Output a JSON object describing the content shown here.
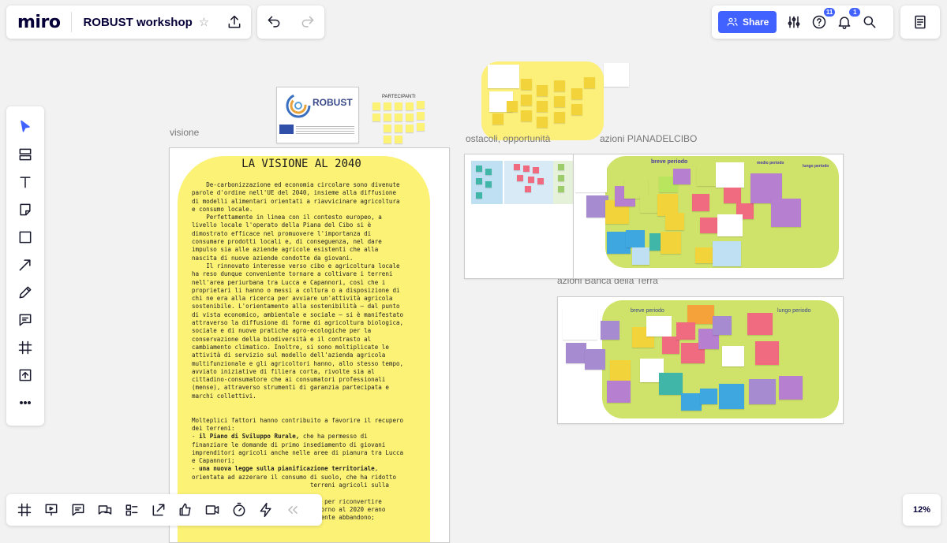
{
  "app": {
    "logo": "miro",
    "board_title": "ROBUST workshop",
    "zoom_level": "12%"
  },
  "toolbar": {
    "share_label": "Share",
    "questions_badge": "11",
    "notifications_badge": "1"
  },
  "canvas": {
    "labels": {
      "visione": "visione",
      "ostacoli": "ostacoli, opportunità",
      "azioni_pianadelcibo": "azioni PIANADELCIBO",
      "azioni_banca": "azioni Banca della Terra",
      "partecipanti": "PARTECIPANTI"
    },
    "robust_logo_text": "ROBUST",
    "vision": {
      "title": "LA VISIONE AL 2040",
      "p1": "    De-carbonizzazione ed economia circolare sono divenute\nparole d'ordine nell'UE del 2040, insieme alla diffusione\ndi modelli alimentari orientati a riavvicinare agricoltura\ne consumo locale.",
      "p2": "    Perfettamente in linea con il contesto europeo, a\nlivello locale l'operato della Piana del Cibo si è\ndimostrato efficace nel promuovere l'importanza di\nconsumare prodotti locali e, di conseguenza, nel dare\nimpulso sia alle aziende agricole esistenti che alla\nnascita di nuove aziende condotte da giovani.",
      "p3": "    Il rinnovato interesse verso cibo e agricoltura locale\nha reso dunque conveniente tornare a coltivare i terreni\nnell'area periurbana tra Lucca e Capannori, così che i\nproprietari li hanno o messi a coltura o a disposizione di\nchi ne era alla ricerca per avviare un'attività agricola\nsostenibile. L'orientamento alla sostenibilità – dal punto\ndi vista economico, ambientale e sociale – si è manifestato\nattraverso la diffusione di forme di agricoltura biologica,\nsociale e di nuove pratiche agro-ecologiche per la\nconservazione della biodiversità e il contrasto al\ncambiamento climatico. Inoltre, si sono moltiplicate le\nattività di servizio sul modello dell'azienda agricola\nmultifunzionale e gli agricoltori hanno, allo stesso tempo,\navviato iniziative di filiera corta, rivolte sia al\ncittadino-consumatore che ai consumatori professionali\n(mense), attraverso strumenti di garanzia partecipata e\nmarchi collettivi.",
      "p4": "Molteplici fattori hanno contribuito a favorire il recupero\ndei terreni:",
      "b1_strong": "il Piano di Sviluppo Rurale,",
      "b1_rest": " che ha permesso di\nfinanziare le domande di primo insediamento di giovani\nimprenditori agricoli anche nelle aree di pianura tra Lucca\ne Capannori;",
      "b2_strong": "una nuova legge sulla pianificazione territoriale",
      "b2_rest": ",\norientata ad azzerare il consumo di suolo, che ha ridotto\n                                 terreni agricoli sulla",
      "b3_rest": "                                  re per riconvertire\n                                  ntorno al 2020 erano\nritornati a bosco a causa del precedente abbandono;"
    },
    "frames": {
      "breve_periodo": "breve periodo",
      "medio_periodo": "medio periodo",
      "lungo_periodo": "lungo periodo"
    }
  }
}
